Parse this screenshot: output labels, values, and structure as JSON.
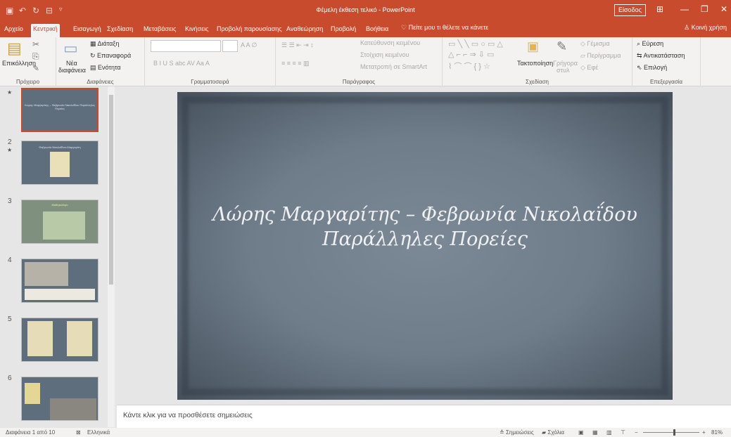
{
  "app": {
    "title": "Φέμελη έκθεση τελικό  -  PowerPoint",
    "signin_label": "Είσοδος"
  },
  "tabs": [
    "Αρχείο",
    "Κεντρική",
    "Εισαγωγή",
    "Σχεδίαση",
    "Μεταβάσεις",
    "Κινήσεις",
    "Προβολή παρουσίασης",
    "Αναθεώρηση",
    "Προβολή",
    "Βοήθεια"
  ],
  "tell_me": "Πείτε μου τι θέλετε να κάνετε",
  "share": "Κοινή χρήση",
  "ribbon": {
    "clipboard": {
      "paste": "Επικόλληση",
      "group": "Πρόχειρο"
    },
    "slides": {
      "new_slide_1": "Νέα",
      "new_slide_2": "διαφάνεια",
      "layout": "Διάταξη",
      "reset": "Επαναφορά",
      "section": "Ενότητα",
      "group": "Διαφάνειες"
    },
    "font": {
      "group": "Γραμματοσειρά"
    },
    "paragraph": {
      "text_direction": "Κατεύθυνση κειμένου",
      "align_text": "Στοίχιση κειμένου",
      "smartart": "Μετατροπή σε SmartArt",
      "group": "Παράγραφος"
    },
    "drawing": {
      "arrange": "Τακτοποίηση",
      "quick_styles_1": "Γρήγορα",
      "quick_styles_2": "στυλ",
      "fill": "Γέμισμα",
      "outline": "Περίγραμμα",
      "effects": "Εφέ",
      "group": "Σχεδίαση"
    },
    "editing": {
      "find": "Εύρεση",
      "replace": "Αντικατάσταση",
      "select": "Επιλογή",
      "group": "Επεξεργασία"
    }
  },
  "thumbnails": [
    {
      "number": "",
      "title": "Λώρης Μαργαρίτης – Φεβρωνία Νικολαΐδου Παράλληλες Πορείες"
    },
    {
      "number": "2",
      "title": "Φεβρωνία Νικολαΐδου-Μαργαρίτη"
    },
    {
      "number": "3",
      "title": "Μαθητολόγιο"
    },
    {
      "number": "4",
      "title": ""
    },
    {
      "number": "5",
      "title": ""
    },
    {
      "number": "6",
      "title": ""
    }
  ],
  "slide": {
    "line1": "Λώρης Μαργαρίτης – Φεβρωνία Νικολαΐδου",
    "line2": "Παράλληλες Πορείες"
  },
  "notes_placeholder": "Κάντε κλικ για να προσθέσετε σημειώσεις",
  "status": {
    "slide_info": "Διαφάνεια 1 από 10",
    "language": "Ελληνικά",
    "notes": "Σημειώσεις",
    "comments": "Σχόλια",
    "zoom": "81%"
  }
}
